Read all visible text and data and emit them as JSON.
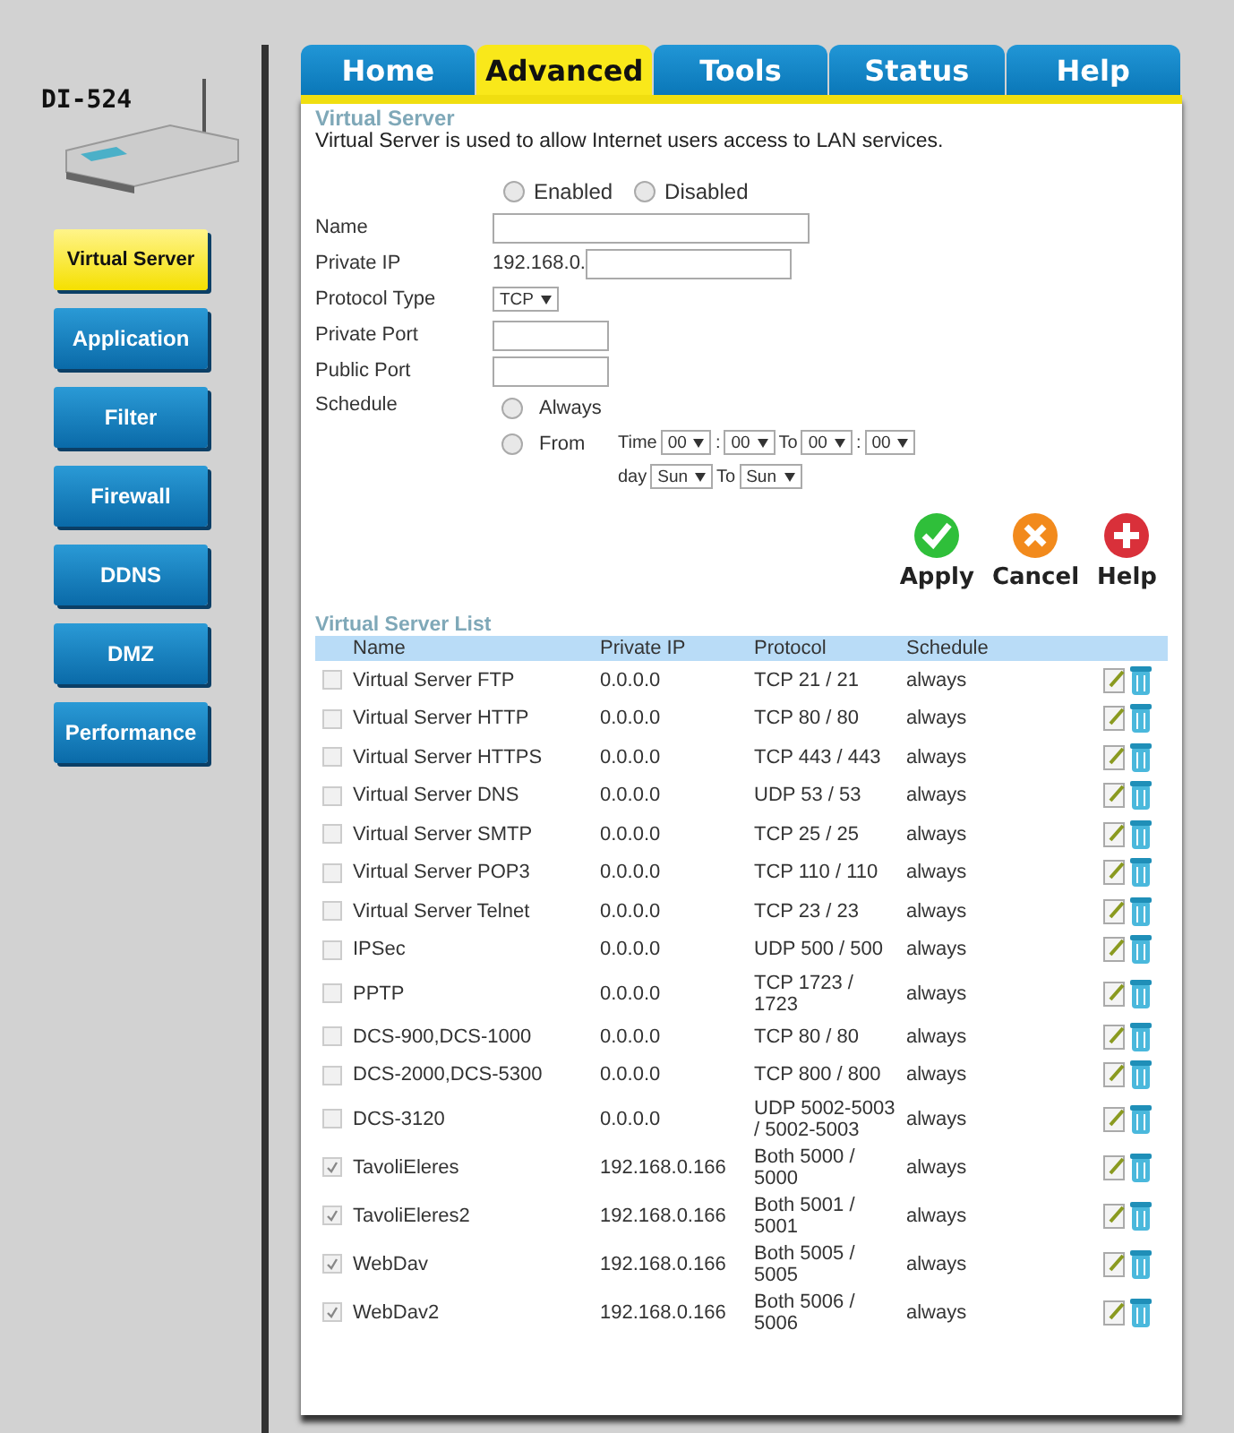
{
  "device": {
    "model": "DI-524"
  },
  "sidebar": {
    "items": [
      {
        "label": "Virtual Server",
        "selected": true
      },
      {
        "label": "Application",
        "selected": false
      },
      {
        "label": "Filter",
        "selected": false
      },
      {
        "label": "Firewall",
        "selected": false
      },
      {
        "label": "DDNS",
        "selected": false
      },
      {
        "label": "DMZ",
        "selected": false
      },
      {
        "label": "Performance",
        "selected": false
      }
    ]
  },
  "tabs": [
    {
      "label": "Home",
      "selected": false
    },
    {
      "label": "Advanced",
      "selected": true
    },
    {
      "label": "Tools",
      "selected": false
    },
    {
      "label": "Status",
      "selected": false
    },
    {
      "label": "Help",
      "selected": false
    }
  ],
  "section": {
    "title": "Virtual Server",
    "description": "Virtual Server is used to allow Internet users access to LAN services."
  },
  "form": {
    "state_options": [
      {
        "label": "Enabled",
        "selected": false
      },
      {
        "label": "Disabled",
        "selected": false
      }
    ],
    "name_label": "Name",
    "private_ip_label": "Private IP",
    "private_ip_prefix": "192.168.0.",
    "protocol_label": "Protocol Type",
    "protocol_value": "TCP",
    "private_port_label": "Private Port",
    "public_port_label": "Public Port",
    "schedule_label": "Schedule",
    "schedule_options": [
      {
        "label": "Always",
        "selected": false
      },
      {
        "label": "From",
        "selected": false
      }
    ],
    "time_label": "Time",
    "time_from": [
      "00",
      "00"
    ],
    "time_from_separator": ":",
    "time_to_label": "To",
    "time_to": [
      "00",
      "00"
    ],
    "time_to_separator": ":",
    "day_label": "day",
    "day_from": "Sun",
    "day_to_label": "To",
    "day_to": "Sun"
  },
  "actions": [
    {
      "kind": "apply",
      "label": "Apply"
    },
    {
      "kind": "cancel",
      "label": "Cancel"
    },
    {
      "kind": "help",
      "label": "Help"
    }
  ],
  "list": {
    "title": "Virtual Server List",
    "columns": [
      "Name",
      "Private IP",
      "Protocol",
      "Schedule"
    ],
    "rows": [
      {
        "checked": false,
        "name": "Virtual Server FTP",
        "ip": "0.0.0.0",
        "protocol": "TCP 21 / 21",
        "schedule": "always"
      },
      {
        "checked": false,
        "name": "Virtual Server HTTP",
        "ip": "0.0.0.0",
        "protocol": "TCP 80 / 80",
        "schedule": "always"
      },
      {
        "checked": false,
        "name": "Virtual Server HTTPS",
        "ip": "0.0.0.0",
        "protocol": "TCP 443 / 443",
        "schedule": "always"
      },
      {
        "checked": false,
        "name": "Virtual Server DNS",
        "ip": "0.0.0.0",
        "protocol": "UDP 53 / 53",
        "schedule": "always"
      },
      {
        "checked": false,
        "name": "Virtual Server SMTP",
        "ip": "0.0.0.0",
        "protocol": "TCP 25 / 25",
        "schedule": "always"
      },
      {
        "checked": false,
        "name": "Virtual Server POP3",
        "ip": "0.0.0.0",
        "protocol": "TCP 110 / 110",
        "schedule": "always"
      },
      {
        "checked": false,
        "name": "Virtual Server Telnet",
        "ip": "0.0.0.0",
        "protocol": "TCP 23 / 23",
        "schedule": "always"
      },
      {
        "checked": false,
        "name": "IPSec",
        "ip": "0.0.0.0",
        "protocol": "UDP 500 / 500",
        "schedule": "always"
      },
      {
        "checked": false,
        "name": "PPTP",
        "ip": "0.0.0.0",
        "protocol": "TCP 1723 / 1723",
        "schedule": "always"
      },
      {
        "checked": false,
        "name": "DCS-900,DCS-1000",
        "ip": "0.0.0.0",
        "protocol": "TCP 80 / 80",
        "schedule": "always"
      },
      {
        "checked": false,
        "name": "DCS-2000,DCS-5300",
        "ip": "0.0.0.0",
        "protocol": "TCP 800 / 800",
        "schedule": "always"
      },
      {
        "checked": false,
        "name": "DCS-3120",
        "ip": "0.0.0.0",
        "protocol": "UDP 5002-5003 / 5002-5003",
        "schedule": "always"
      },
      {
        "checked": true,
        "name": "TavoliEleres",
        "ip": "192.168.0.166",
        "protocol": "Both 5000 / 5000",
        "schedule": "always"
      },
      {
        "checked": true,
        "name": "TavoliEleres2",
        "ip": "192.168.0.166",
        "protocol": "Both 5001 / 5001",
        "schedule": "always"
      },
      {
        "checked": true,
        "name": "WebDav",
        "ip": "192.168.0.166",
        "protocol": "Both 5005 / 5005",
        "schedule": "always"
      },
      {
        "checked": true,
        "name": "WebDav2",
        "ip": "192.168.0.166",
        "protocol": "Both 5006 / 5006",
        "schedule": "always"
      }
    ]
  }
}
